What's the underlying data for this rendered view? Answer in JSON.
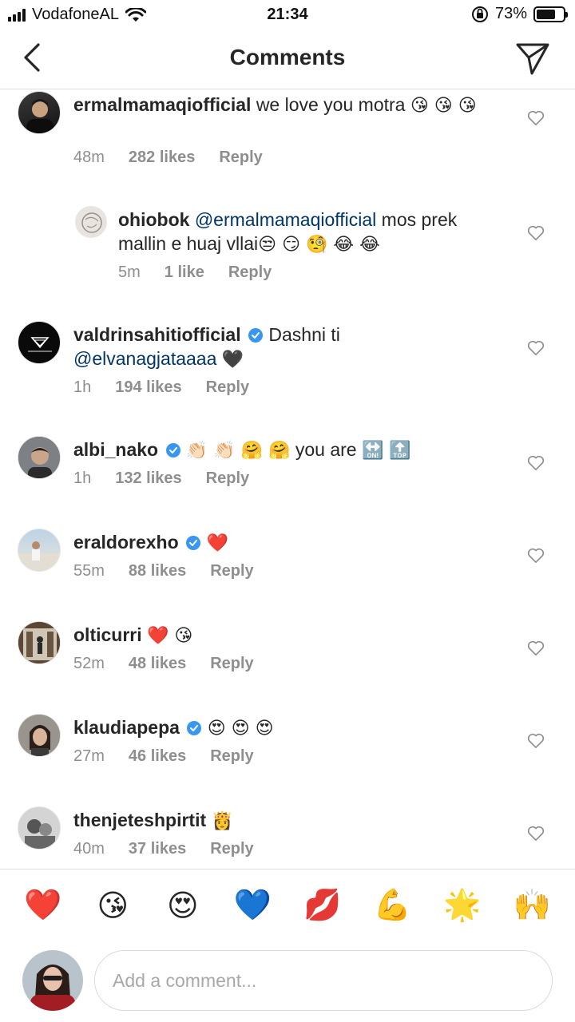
{
  "status_bar": {
    "carrier": "VodafoneAL",
    "time": "21:34",
    "battery_percent": "73%",
    "battery_level": 0.73
  },
  "header": {
    "title": "Comments"
  },
  "comments": [
    {
      "user": "ermalmamaqiofficial",
      "text": "we love you motra",
      "emoji": "😘 😘 😘",
      "time": "48m",
      "likes": "282 likes",
      "reply": "Reply"
    },
    {
      "user": "ohiobok",
      "mention": "@ermalmamaqiofficial",
      "text": "mos prek mallin e huaj vllai",
      "emoji": "😒 😏 🧐 😂 😂",
      "time": "5m",
      "likes": "1 like",
      "reply": "Reply"
    },
    {
      "user": "valdrinsahitiofficial",
      "text": "Dashni  ti",
      "mention": "@elvanagjataaaa",
      "emoji": "🖤",
      "time": "1h",
      "likes": "194 likes",
      "reply": "Reply"
    },
    {
      "user": "albi_nako",
      "emoji_before": "👏🏻 👏🏻 🤗 🤗",
      "text": "you are",
      "emoji": "🔛 🔝",
      "time": "1h",
      "likes": "132 likes",
      "reply": "Reply"
    },
    {
      "user": "eraldorexho",
      "emoji": "❤️",
      "time": "55m",
      "likes": "88 likes",
      "reply": "Reply"
    },
    {
      "user": "olticurri",
      "emoji": "❤️ 😘",
      "time": "52m",
      "likes": "48 likes",
      "reply": "Reply"
    },
    {
      "user": "klaudiapepa",
      "emoji": "😍 😍 😍",
      "time": "27m",
      "likes": "46 likes",
      "reply": "Reply"
    },
    {
      "user": "thenjeteshpirtit",
      "emoji": "👸",
      "time": "40m",
      "likes": "37 likes",
      "reply": "Reply"
    }
  ],
  "emoji_bar": [
    "❤️",
    "😘",
    "😍",
    "💙",
    "💋",
    "💪",
    "🌟",
    "🙌"
  ],
  "input": {
    "placeholder": "Add a comment..."
  },
  "colors": {
    "verified": "#3897f0",
    "mention": "#003569",
    "muted": "#8e8e8e",
    "divider": "#dbdbdb"
  }
}
